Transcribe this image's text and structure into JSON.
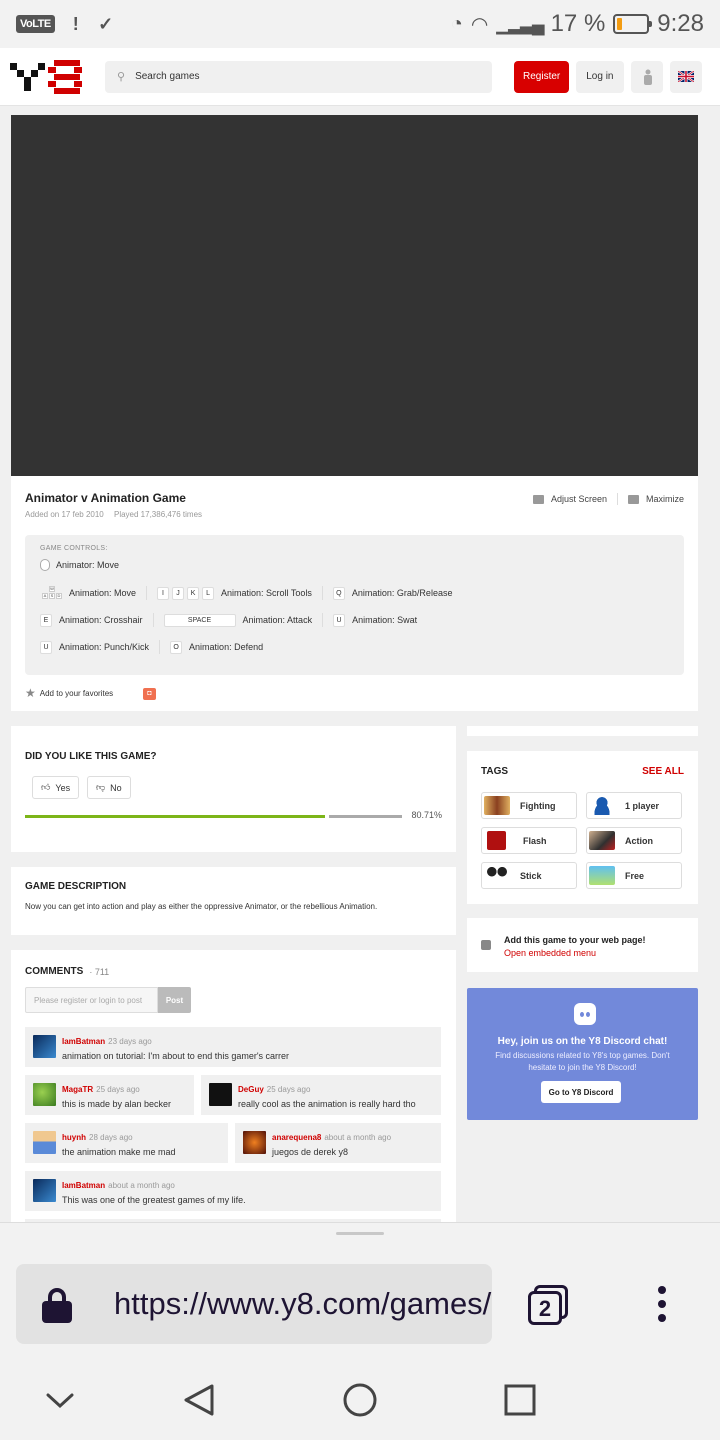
{
  "status_bar": {
    "volte": "VoLTE",
    "battery_percent": "17 %",
    "battery_level": 0.17,
    "time": "9:28"
  },
  "header": {
    "search_placeholder": "Search games",
    "register_label": "Register",
    "login_label": "Log in",
    "accent_color": "#d80000"
  },
  "game": {
    "title": "Animator v Animation Game",
    "added": "Added on 17 feb 2010",
    "played": "Played 17,386,476 times",
    "adjust_screen": "Adjust Screen",
    "maximize": "Maximize",
    "controls_heading": "GAME CONTROLS:",
    "controls": {
      "mouse_label": "Animator: Move",
      "wasd_keys": [
        "W",
        "A",
        "S",
        "D"
      ],
      "move_label": "Animation: Move",
      "scroll_keys": [
        "I",
        "J",
        "K",
        "L"
      ],
      "scroll_label": "Animation: Scroll Tools",
      "grab_key": "Q",
      "grab_label": "Animation: Grab/Release",
      "crosshair_key": "E",
      "crosshair_label": "Animation: Crosshair",
      "attack_key": "SPACE",
      "attack_label": "Animation: Attack",
      "swat_key": "U",
      "swat_label": "Animation: Swat",
      "punch_key": "U",
      "punch_label": "Animation: Punch/Kick",
      "defend_key": "O",
      "defend_label": "Animation: Defend"
    },
    "favorites_label": "Add to your favorites"
  },
  "rating": {
    "title": "DID YOU LIKE THIS GAME?",
    "yes_label": "Yes",
    "no_label": "No",
    "percent_label": "80.71%",
    "percent_value": 0.8071
  },
  "description": {
    "title": "GAME DESCRIPTION",
    "text": "Now you can get into action and play as either the oppressive Animator, or the rebellious Animation."
  },
  "comments": {
    "title": "COMMENTS",
    "count": "· 711",
    "input_placeholder": "Please register or login to post",
    "post_label": "Post",
    "items": [
      {
        "user": "IamBatman",
        "time": "23 days ago",
        "text": "animation on tutorial: I'm about to end this gamer's carrer"
      },
      {
        "user": "MagaTR",
        "time": "25 days ago",
        "text": "this is made by alan becker"
      },
      {
        "user": "DeGuy",
        "time": "25 days ago",
        "text": "really cool as the animation is really hard tho"
      },
      {
        "user": "huynh",
        "time": "28 days ago",
        "text": "the animation make me mad"
      },
      {
        "user": "anarequena8",
        "time": "about a month ago",
        "text": "juegos de derek y8"
      },
      {
        "user": "IamBatman",
        "time": "about a month ago",
        "text": "This was one of the greatest games of my life."
      }
    ]
  },
  "tags": {
    "title": "TAGS",
    "see_all": "SEE ALL",
    "items": [
      {
        "label": "Fighting",
        "icon": "fighting-tag-icon"
      },
      {
        "label": "1 player",
        "icon": "one-player-tag-icon"
      },
      {
        "label": "Flash",
        "icon": "flash-tag-icon"
      },
      {
        "label": "Action",
        "icon": "action-tag-icon"
      },
      {
        "label": "Stick",
        "icon": "stick-tag-icon"
      },
      {
        "label": "Free",
        "icon": "free-tag-icon"
      }
    ]
  },
  "embed": {
    "title": "Add this game to your web page!",
    "link": "Open embedded menu"
  },
  "discord": {
    "title": "Hey, join us on the Y8 Discord chat!",
    "text": "Find discussions related to Y8's top games. Don't hesitate to join the Y8 Discord!",
    "button": "Go to Y8 Discord",
    "color": "#7289da"
  },
  "browser": {
    "url": "https://www.y8.com/games/",
    "tab_count": "2"
  }
}
